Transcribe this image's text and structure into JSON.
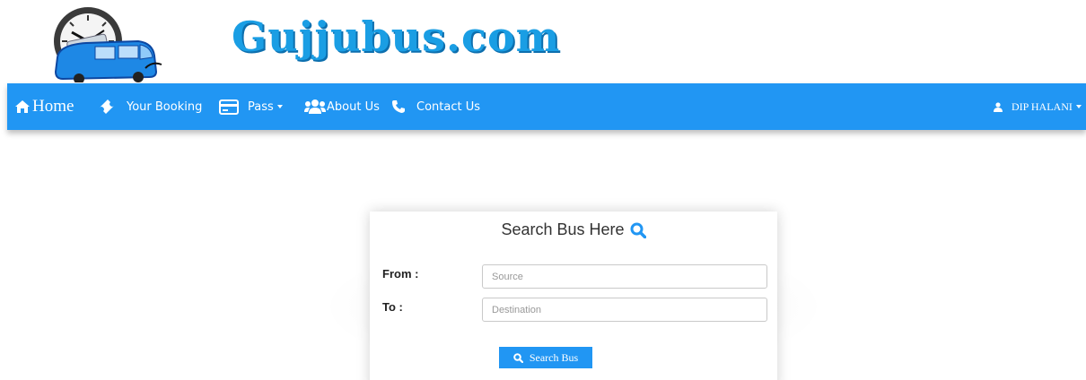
{
  "site": {
    "title": "Gujjubus.com",
    "brand_color": "#1a9ee4",
    "logo_icon": "bus-clock-logo-icon"
  },
  "navbar": {
    "color": "#2196f3",
    "items": [
      {
        "label": "Home",
        "icon": "home-icon"
      },
      {
        "label": "Your Booking",
        "icon": "ticket-icon"
      },
      {
        "label": "Pass",
        "icon": "credit-card-icon",
        "dropdown": true
      },
      {
        "label": "About Us",
        "icon": "users-icon"
      },
      {
        "label": "Contact Us",
        "icon": "phone-icon"
      }
    ],
    "user": {
      "label": "DIP HALANI",
      "icon": "user-icon",
      "dropdown": true
    }
  },
  "search_card": {
    "title": "Search Bus Here",
    "title_icon": "search-icon",
    "from_label": "From :",
    "from_placeholder": "Source",
    "from_value": "",
    "to_label": "To :",
    "to_placeholder": "Destination",
    "to_value": "",
    "button_label": "Search Bus",
    "button_icon": "search-icon"
  }
}
